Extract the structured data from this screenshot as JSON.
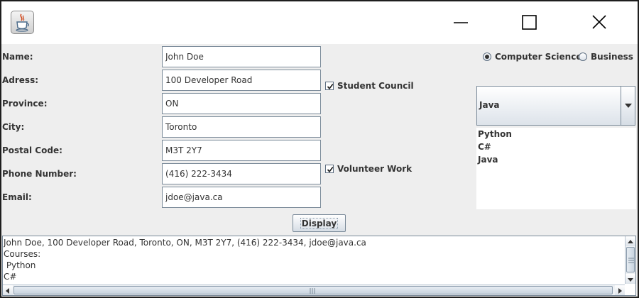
{
  "window": {
    "icons": {
      "app": "java-coffee-cup-icon",
      "minimize": "minimize-icon",
      "maximize": "maximize-icon",
      "close": "close-icon"
    }
  },
  "form": {
    "fields": [
      {
        "label": "Name:",
        "value": "John Doe"
      },
      {
        "label": "Adress:",
        "value": "100 Developer Road"
      },
      {
        "label": "Province:",
        "value": "ON"
      },
      {
        "label": "City:",
        "value": "Toronto"
      },
      {
        "label": "Postal Code:",
        "value": "M3T 2Y7"
      },
      {
        "label": "Phone Number:",
        "value": "(416) 222-3434"
      },
      {
        "label": "Email:",
        "value": "jdoe@java.ca"
      }
    ]
  },
  "checkboxes": {
    "student_council": {
      "label": "Student Council",
      "checked": true
    },
    "volunteer_work": {
      "label": "Volunteer Work",
      "checked": true
    }
  },
  "program": {
    "options": [
      {
        "label": "Computer Science",
        "selected": true
      },
      {
        "label": "Business",
        "selected": false
      }
    ]
  },
  "course_combo": {
    "selected": "Java"
  },
  "course_list": {
    "items": [
      "Python",
      "C#",
      "Java"
    ]
  },
  "display_button": {
    "label": "Display"
  },
  "output": {
    "text": "John Doe, 100 Developer Road, Toronto, ON, M3T 2Y7, (416) 222-3434, jdoe@java.ca\nCourses:\n Python\nC#"
  },
  "colors": {
    "text": "#333333",
    "border": "#7a8a99",
    "panel": "#eeeeee",
    "titlebar": "#ffffff"
  }
}
